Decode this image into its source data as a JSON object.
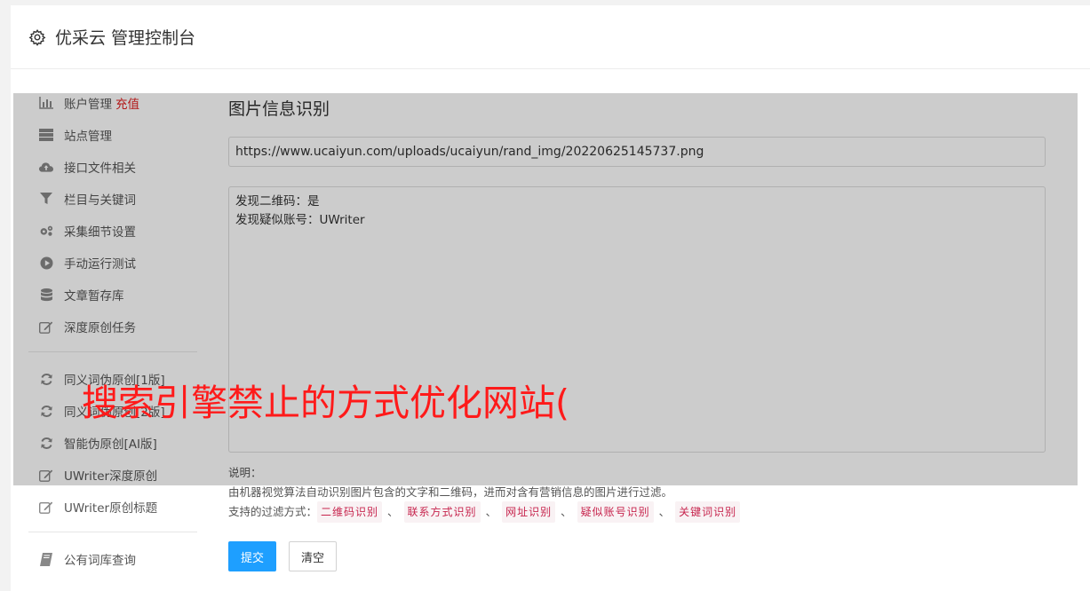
{
  "header": {
    "title": "优采云 管理控制台",
    "icon": "gear-icon"
  },
  "sidebar": {
    "items": [
      {
        "label": "账户管理",
        "badge": "充值",
        "icon": "bar-chart-icon"
      },
      {
        "label": "站点管理",
        "icon": "server-icon"
      },
      {
        "label": "接口文件相关",
        "icon": "cloud-upload-icon"
      },
      {
        "label": "栏目与关键词",
        "icon": "filter-icon"
      },
      {
        "label": "采集细节设置",
        "icon": "cogs-icon"
      },
      {
        "label": "手动运行测试",
        "icon": "play-circle-icon"
      },
      {
        "label": "文章暂存库",
        "icon": "database-icon"
      },
      {
        "label": "深度原创任务",
        "icon": "edit-icon"
      }
    ],
    "items2": [
      {
        "label": "同义词伪原创[1版]",
        "icon": "refresh-icon"
      },
      {
        "label": "同义词伪原创[2版]",
        "icon": "refresh-icon"
      },
      {
        "label": "智能伪原创[AI版]",
        "icon": "refresh-icon"
      },
      {
        "label": "UWriter深度原创",
        "icon": "edit-icon"
      },
      {
        "label": "UWriter原创标题",
        "icon": "edit-icon"
      }
    ],
    "items3": [
      {
        "label": "公有词库查询",
        "icon": "book-icon"
      }
    ]
  },
  "main": {
    "heading": "图片信息识别",
    "url_value": "https://www.ucaiyun.com/uploads/ucaiyun/rand_img/20220625145737.png",
    "result_text": "发现二维码：是\n发现疑似账号：UWriter",
    "desc_label": "说明：",
    "desc_text": "由机器视觉算法自动识别图片包含的文字和二维码，进而对含有营销信息的图片进行过滤。",
    "filters_label": "支持的过滤方式：",
    "filters": [
      "二维码识别",
      "联系方式识别",
      "网址识别",
      "疑似账号识别",
      "关键词识别"
    ],
    "submit_label": "提交",
    "clear_label": "清空"
  },
  "overlay": {
    "headline": "搜索引擎禁止的方式优化网站("
  },
  "colors": {
    "accent": "#1e9fff",
    "danger": "#e02020",
    "headline": "#ff1a1a",
    "tag_text": "#c7254e"
  }
}
